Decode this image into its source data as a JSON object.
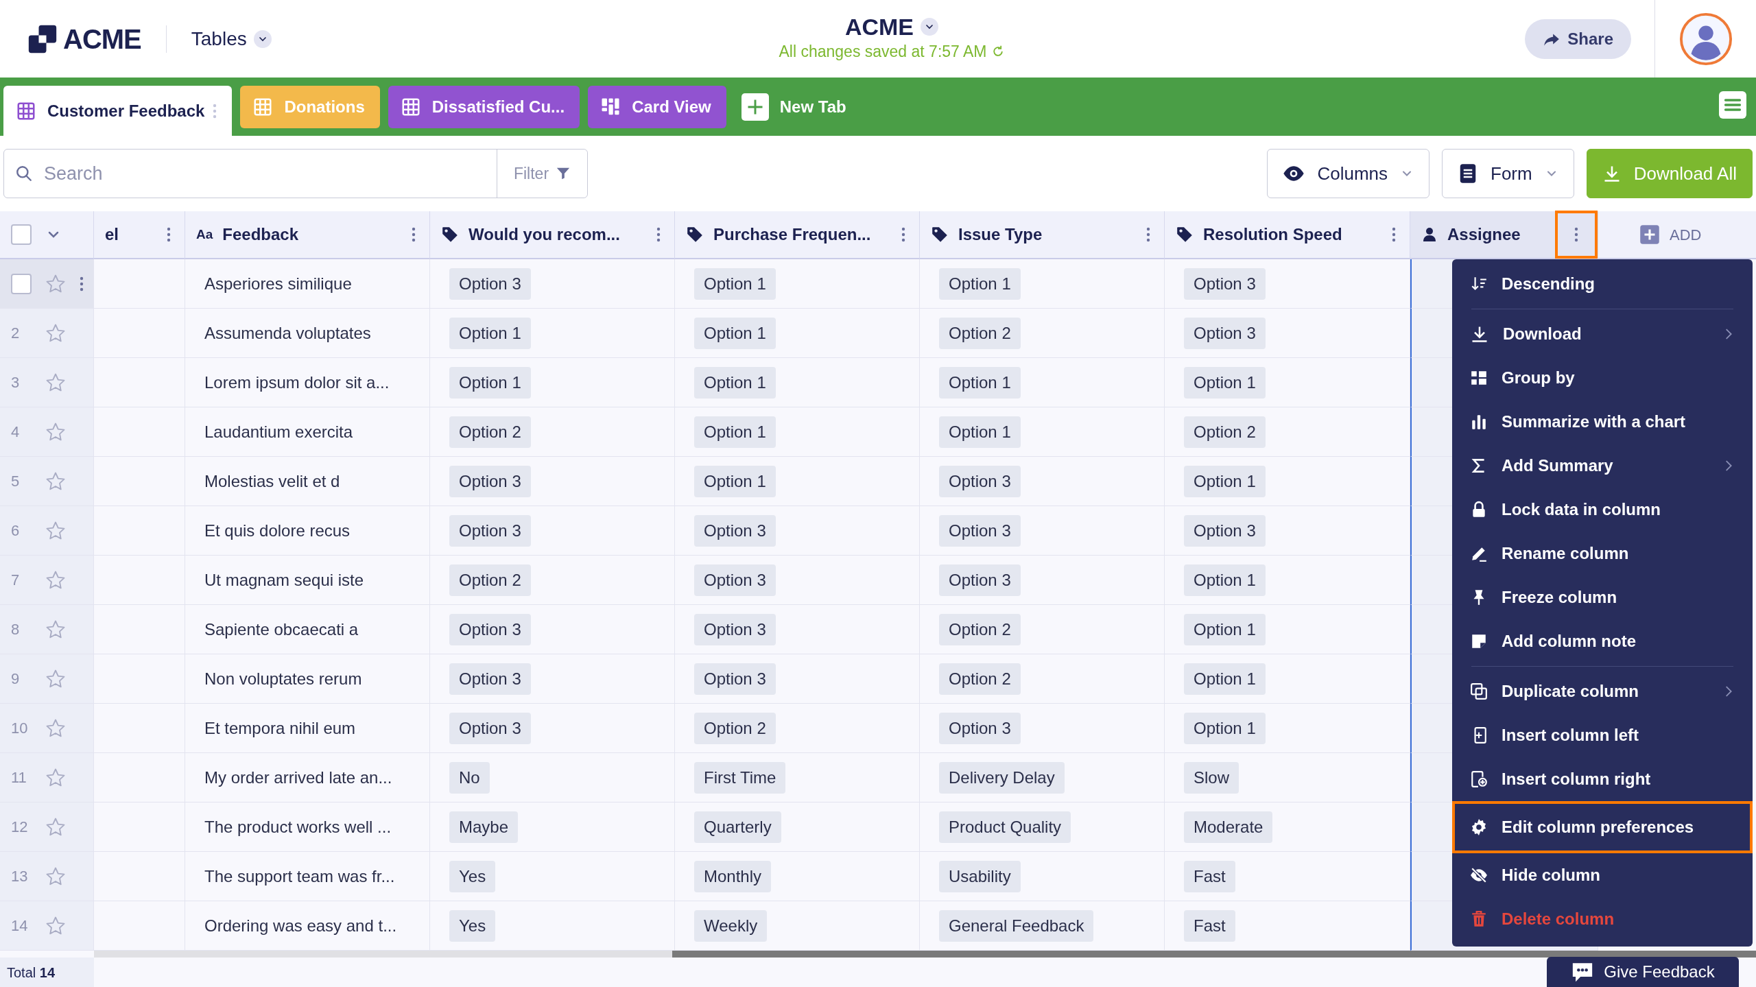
{
  "header": {
    "logo": "ACME",
    "app_menu": "Tables",
    "title": "ACME",
    "save_status": "All changes saved at 7:57 AM",
    "share": "Share"
  },
  "tabs": [
    {
      "label": "Customer Feedback",
      "kind": "table",
      "color": "#8e4fd0",
      "selected": true
    },
    {
      "label": "Donations",
      "kind": "table",
      "color": "#f3b94b",
      "selected": false
    },
    {
      "label": "Dissatisfied Cu...",
      "kind": "table",
      "color": "#9153d0",
      "selected": false
    },
    {
      "label": "Card View",
      "kind": "cards",
      "color": "#9153d0",
      "selected": false
    }
  ],
  "new_tab": "New Tab",
  "toolbar": {
    "search": {
      "placeholder": "Search"
    },
    "filter": "Filter",
    "buttons": [
      {
        "label": "Columns",
        "kind": "outline"
      },
      {
        "label": "Form",
        "kind": "outline"
      },
      {
        "label": "Download All",
        "kind": "primary"
      }
    ]
  },
  "table": {
    "select_all_checked": false,
    "columns": [
      {
        "label": "el",
        "kind": "blank",
        "menu_open": false
      },
      {
        "label": "Feedback",
        "kind": "text",
        "icon_label": "Aa",
        "menu_open": false
      },
      {
        "label": "Would you recom...",
        "kind": "tag",
        "menu_open": false
      },
      {
        "label": "Purchase Frequen...",
        "kind": "tag",
        "menu_open": false
      },
      {
        "label": "Issue Type",
        "kind": "tag",
        "menu_open": false
      },
      {
        "label": "Resolution Speed",
        "kind": "tag",
        "menu_open": false
      },
      {
        "label": "Assignee",
        "kind": "person",
        "menu_open": true
      }
    ],
    "add_column": "ADD",
    "rows": [
      {
        "hovered": true,
        "checked": false,
        "starred": false,
        "cells": [
          "",
          "Asperiores similique",
          "Option 3",
          "Option 1",
          "Option 1",
          "Option 3",
          ""
        ]
      },
      {
        "number": "2",
        "hovered": false,
        "starred": false,
        "cells": [
          "",
          "Assumenda voluptates",
          "Option 1",
          "Option 1",
          "Option 2",
          "Option 3",
          ""
        ]
      },
      {
        "number": "3",
        "hovered": false,
        "starred": false,
        "cells": [
          "",
          "Lorem ipsum dolor sit a...",
          "Option 1",
          "Option 1",
          "Option 1",
          "Option 1",
          ""
        ]
      },
      {
        "number": "4",
        "hovered": false,
        "starred": false,
        "cells": [
          "",
          "Laudantium exercita",
          "Option 2",
          "Option 1",
          "Option 1",
          "Option 2",
          ""
        ]
      },
      {
        "number": "5",
        "hovered": false,
        "starred": false,
        "cells": [
          "",
          "Molestias velit et d",
          "Option 3",
          "Option 1",
          "Option 3",
          "Option 1",
          ""
        ]
      },
      {
        "number": "6",
        "hovered": false,
        "starred": false,
        "cells": [
          "",
          "Et quis dolore recus",
          "Option 3",
          "Option 3",
          "Option 3",
          "Option 3",
          ""
        ]
      },
      {
        "number": "7",
        "hovered": false,
        "starred": false,
        "cells": [
          "",
          "Ut magnam sequi iste",
          "Option 2",
          "Option 3",
          "Option 3",
          "Option 1",
          ""
        ]
      },
      {
        "number": "8",
        "hovered": false,
        "starred": false,
        "cells": [
          "",
          "Sapiente obcaecati a",
          "Option 3",
          "Option 3",
          "Option 2",
          "Option 1",
          ""
        ]
      },
      {
        "number": "9",
        "hovered": false,
        "starred": false,
        "cells": [
          "",
          "Non voluptates rerum",
          "Option 3",
          "Option 3",
          "Option 2",
          "Option 1",
          ""
        ]
      },
      {
        "number": "10",
        "hovered": false,
        "starred": false,
        "cells": [
          "",
          "Et tempora nihil eum",
          "Option 3",
          "Option 2",
          "Option 3",
          "Option 1",
          ""
        ]
      },
      {
        "number": "11",
        "hovered": false,
        "starred": false,
        "cells": [
          "",
          "My order arrived late an...",
          "No",
          "First Time",
          "Delivery Delay",
          "Slow",
          ""
        ]
      },
      {
        "number": "12",
        "hovered": false,
        "starred": false,
        "cells": [
          "",
          "The product works well ...",
          "Maybe",
          "Quarterly",
          "Product Quality",
          "Moderate",
          ""
        ]
      },
      {
        "number": "13",
        "hovered": false,
        "starred": false,
        "cells": [
          "",
          "The support team was fr...",
          "Yes",
          "Monthly",
          "Usability",
          "Fast",
          ""
        ]
      },
      {
        "number": "14",
        "hovered": false,
        "starred": false,
        "cells": [
          "",
          "Ordering was easy and t...",
          "Yes",
          "Weekly",
          "General Feedback",
          "Fast",
          ""
        ]
      }
    ],
    "total": "Total **14**"
  },
  "column_menu": [
    {
      "kind": "item",
      "label": "Descending",
      "submenu": false,
      "danger": false,
      "highlighted": false
    },
    {
      "kind": "divider"
    },
    {
      "kind": "item",
      "label": "Download",
      "submenu": true,
      "danger": false,
      "highlighted": false
    },
    {
      "kind": "item",
      "label": "Group by",
      "submenu": false,
      "danger": false,
      "highlighted": false
    },
    {
      "kind": "item",
      "label": "Summarize with a chart",
      "submenu": false,
      "danger": false,
      "highlighted": false
    },
    {
      "kind": "item",
      "label": "Add Summary",
      "submenu": true,
      "danger": false,
      "highlighted": false
    },
    {
      "kind": "item",
      "label": "Lock data in column",
      "submenu": false,
      "danger": false,
      "highlighted": false
    },
    {
      "kind": "item",
      "label": "Rename column",
      "submenu": false,
      "danger": false,
      "highlighted": false
    },
    {
      "kind": "item",
      "label": "Freeze column",
      "submenu": false,
      "danger": false,
      "highlighted": false
    },
    {
      "kind": "item",
      "label": "Add column note",
      "submenu": false,
      "danger": false,
      "highlighted": false
    },
    {
      "kind": "divider"
    },
    {
      "kind": "item",
      "label": "Duplicate column",
      "submenu": true,
      "danger": false,
      "highlighted": false
    },
    {
      "kind": "item",
      "label": "Insert column left",
      "submenu": false,
      "danger": false,
      "highlighted": false
    },
    {
      "kind": "item",
      "label": "Insert column right",
      "submenu": false,
      "danger": false,
      "highlighted": false
    },
    {
      "kind": "item",
      "label": "Edit column preferences",
      "submenu": false,
      "danger": false,
      "highlighted": true
    },
    {
      "kind": "item",
      "label": "Hide column",
      "submenu": false,
      "danger": false,
      "highlighted": false
    },
    {
      "kind": "item",
      "label": "Delete column",
      "submenu": false,
      "danger": true,
      "highlighted": false
    }
  ],
  "feedback_button": "Give Feedback"
}
